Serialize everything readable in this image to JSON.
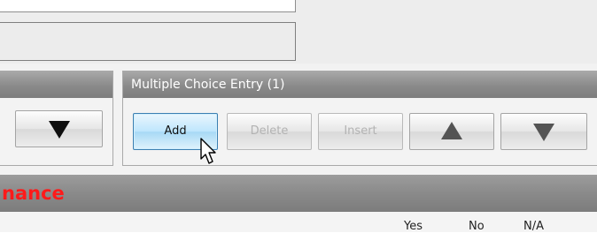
{
  "multiple_choice": {
    "header": "Multiple Choice Entry (1)",
    "add_label": "Add",
    "delete_label": "Delete",
    "insert_label": "Insert",
    "move_up_icon": "triangle-up-icon",
    "move_down_icon": "triangle-down-icon"
  },
  "left_panel": {
    "move_down_icon": "triangle-down-icon"
  },
  "section": {
    "title": "nance",
    "title_color": "#ff1a1a"
  },
  "columns": [
    "Yes",
    "No",
    "N/A"
  ],
  "colors": {
    "active_button": "#bee6fd",
    "header_gray": "#8a8a8a"
  }
}
